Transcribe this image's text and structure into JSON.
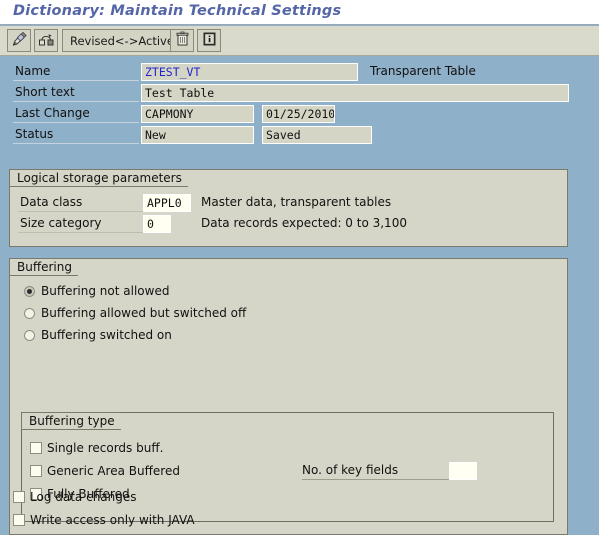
{
  "window": {
    "title": "Dictionary: Maintain Technical Settings"
  },
  "toolbar": {
    "buttons": [
      {
        "name": "display-change-button",
        "icon": "pencil-icon",
        "label": ""
      },
      {
        "name": "navigate-button",
        "icon": "hierarchy-icon",
        "label": ""
      },
      {
        "name": "revised-active-button",
        "icon": "",
        "label": "Revised<->Active"
      },
      {
        "name": "delete-button",
        "icon": "trash-icon",
        "label": ""
      },
      {
        "name": "info-button",
        "icon": "info-icon",
        "label": ""
      }
    ]
  },
  "header_fields": {
    "name_label": "Name",
    "name_value": "ZTEST_VT",
    "table_type": "Transparent Table",
    "short_text_label": "Short text",
    "short_text_value": "Test Table",
    "last_change_label": "Last Change",
    "last_change_user": "CAPMONY",
    "last_change_date": "01/25/2010",
    "status_label": "Status",
    "status_value": "New",
    "status_saved": "Saved"
  },
  "logical_storage": {
    "group_title": "Logical storage parameters",
    "data_class_label": "Data class",
    "data_class_value": "APPL0",
    "data_class_desc": "Master data, transparent tables",
    "size_category_label": "Size category",
    "size_category_value": "0",
    "size_category_desc": "Data records expected: 0 to 3,100"
  },
  "buffering": {
    "group_title": "Buffering",
    "options": [
      {
        "label": "Buffering not allowed",
        "selected": true
      },
      {
        "label": "Buffering allowed but switched off",
        "selected": false
      },
      {
        "label": "Buffering switched on",
        "selected": false
      }
    ],
    "type_group_title": "Buffering type",
    "type_options": [
      {
        "label": "Single records buff.",
        "checked": false
      },
      {
        "label": "Generic Area Buffered",
        "checked": false
      },
      {
        "label": "Fully Buffered",
        "checked": false
      }
    ],
    "key_fields_label": "No. of key fields",
    "key_fields_value": ""
  },
  "footer": {
    "options": [
      {
        "label": "Log data changes",
        "checked": false
      },
      {
        "label": "Write access only with JAVA",
        "checked": false
      }
    ]
  },
  "colors": {
    "background": "#8fb0c9",
    "group_fill": "#d6d6c8",
    "title_text": "#5566a6",
    "field_value": "#2222cc",
    "toolbar": "#d9d9cc"
  }
}
